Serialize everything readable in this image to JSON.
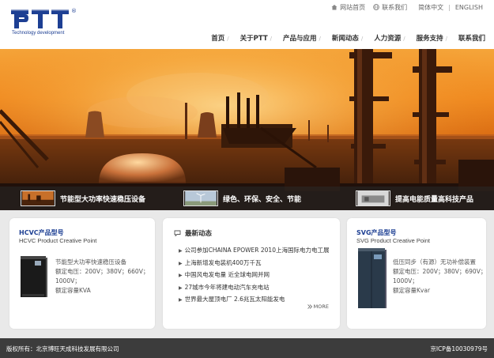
{
  "brand": {
    "logo_text": "PTT",
    "registered_mark": "®",
    "tagline": "Technology development",
    "primary_color": "#1d3f93"
  },
  "top_links": {
    "home": {
      "label": "网站首页",
      "icon": "home-icon"
    },
    "contact": {
      "label": "联系我们",
      "icon": "globe-icon"
    },
    "lang_cn": "简体中文",
    "separator": "|",
    "lang_en": "ENGLISH"
  },
  "nav": {
    "items": [
      {
        "label": "首页"
      },
      {
        "label": "关于PTT"
      },
      {
        "label": "产品与应用"
      },
      {
        "label": "新闻动态"
      },
      {
        "label": "人力资源"
      },
      {
        "label": "服务支持"
      },
      {
        "label": "联系我们"
      }
    ],
    "separator": "/"
  },
  "banner": {
    "features": [
      {
        "label": "节能型大功率快速稳压设备"
      },
      {
        "label": "绿色、环保、安全、节能"
      },
      {
        "label": "提高电能质量高科技产品"
      }
    ]
  },
  "cards": {
    "hcvc": {
      "title": "HCVC产品型号",
      "subtitle": "HCVC Product Creative Point",
      "desc": [
        "节能型大功率快速稳压设备",
        "额定电压：200V；380V；660V；",
        "1000V；",
        "额定容量KVA"
      ]
    },
    "news": {
      "title": "最新动态",
      "items": [
        "公司参加CHAINA EPOWER 2010上海国际电力电工展",
        "上海新增发电装机400万千瓦",
        "中国风电发电量 近全球电网并网",
        "27城市今年将建电动汽车充电站",
        "世界最大屋顶电厂 2.6兆瓦太阳能发电"
      ],
      "bullet": "▶",
      "more": "MORE"
    },
    "svg": {
      "title": "SVG产品型号",
      "subtitle": "SVG Product Creative Point",
      "desc": [
        "低压同步（有源）无功补偿装置",
        "额定电压：200V；380V；690V；",
        "1000V；",
        "额定容量Kvar"
      ]
    }
  },
  "footer": {
    "copyright": "版权所有：北京博旺天成科技发展有限公司",
    "icp": "京ICP备10030979号"
  },
  "colors": {
    "footer_bg": "#3c3c3c",
    "content_bg": "#e9e9e9",
    "banner_sky": "#f08a20"
  }
}
